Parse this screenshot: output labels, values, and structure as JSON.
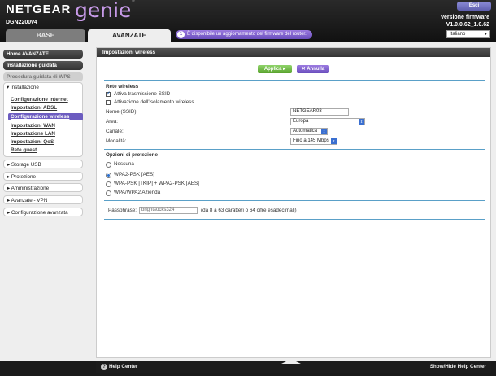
{
  "header": {
    "brand": "NETGEAR",
    "genie": "genie",
    "model": "DGN2200v4",
    "exit_label": "Esci",
    "fw_label": "Versione firmware",
    "fw_version": "V1.0.0.62_1.0.62",
    "language": "Italiano"
  },
  "tabs": {
    "base": "BASE",
    "advanced": "AVANZATE"
  },
  "notice": "È disponibile un aggiornamento del firmware del router.",
  "sidebar": {
    "home": "Home AVANZATE",
    "setup_wizard": "Installazione guidata",
    "wps": "Procedura guidata di WPS",
    "installation": "▾ Installazione",
    "sub_items": [
      "Configurazione Internet",
      "Impostazioni ADSL",
      "Configurazione wireless",
      "Impostazioni WAN",
      "Impostazione LAN",
      "Impostazioni QoS",
      "Rete guest"
    ],
    "storage": "▸ Storage USB",
    "protection": "▸ Protezione",
    "admin": "▸ Amministrazione",
    "vpn": "▸ Avanzate - VPN",
    "advanced_config": "▸ Configurazione avanzata"
  },
  "content": {
    "title": "Impostazioni wireless",
    "apply": "Applica ▸",
    "cancel": "✕ Annulla",
    "wireless_section": "Rete wireless",
    "enable_ssid": "Attiva trasmissione SSID",
    "isolation": "Attivazione dell'isolamento wireless",
    "ssid_label": "Nome (SSID):",
    "ssid_value": "NETGEAR03",
    "region_label": "Area:",
    "region_value": "Europa",
    "channel_label": "Canale:",
    "channel_value": "Automatica",
    "mode_label": "Modalità:",
    "mode_value": "Fino a 145 Mbps",
    "security_section": "Opzioni di protezione",
    "opt_none": "Nessuna",
    "opt_wpa2": "WPA2-PSK [AES]",
    "opt_mixed": "WPA-PSK [TKIP] + WPA2-PSK [AES]",
    "opt_enterprise": "WPA/WPA2 Azienda",
    "passphrase_label": "Passphrase:",
    "passphrase_value": "brightsocks324",
    "passphrase_hint": "(da 8 a 63 caratteri o 64 cifre esadecimali)"
  },
  "footer": {
    "help_left": "Help Center",
    "help_right": "Show/Hide Help Center"
  }
}
